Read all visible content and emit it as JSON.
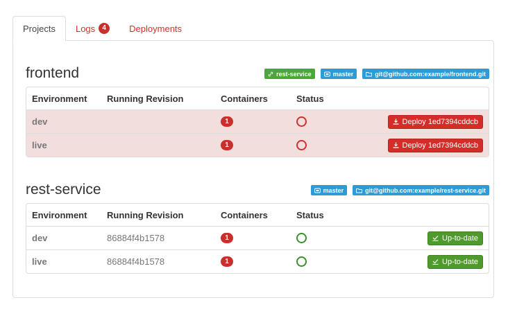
{
  "tabs": [
    {
      "label": "Projects",
      "active": true
    },
    {
      "label": "Logs",
      "count": "4"
    },
    {
      "label": "Deployments"
    }
  ],
  "table_headers": {
    "environment": "Environment",
    "revision": "Running Revision",
    "containers": "Containers",
    "status": "Status"
  },
  "projects": [
    {
      "name": "frontend",
      "labels": [
        {
          "icon": "link-icon",
          "text": "rest-service",
          "color": "#4ca63a"
        },
        {
          "icon": "branch-icon",
          "text": "master",
          "color": "#2e9ad6"
        },
        {
          "icon": "folder-icon",
          "text": "git@github.com:example/frontend.git",
          "color": "#2e9ad6"
        }
      ],
      "rows": [
        {
          "env": "dev",
          "revision": "",
          "containers": "1",
          "status": "down",
          "action": "Deploy 1ed7394cddcb"
        },
        {
          "env": "live",
          "revision": "",
          "containers": "1",
          "status": "down",
          "action": "Deploy 1ed7394cddcb"
        }
      ]
    },
    {
      "name": "rest-service",
      "labels": [
        {
          "icon": "branch-icon",
          "text": "master",
          "color": "#2e9ad6"
        },
        {
          "icon": "folder-icon",
          "text": "git@github.com:example/rest-service.git",
          "color": "#2e9ad6"
        }
      ],
      "rows": [
        {
          "env": "dev",
          "revision": "86884f4b1578",
          "containers": "1",
          "status": "up",
          "action": "Up-to-date"
        },
        {
          "env": "live",
          "revision": "86884f4b1578",
          "containers": "1",
          "status": "up",
          "action": "Up-to-date"
        }
      ]
    }
  ],
  "colors": {
    "accent_red": "#d0312d",
    "label_green": "#4ca63a",
    "label_blue": "#2e9ad6",
    "button_green": "#4f9a2c",
    "error_row_bg": "#f3dede"
  }
}
